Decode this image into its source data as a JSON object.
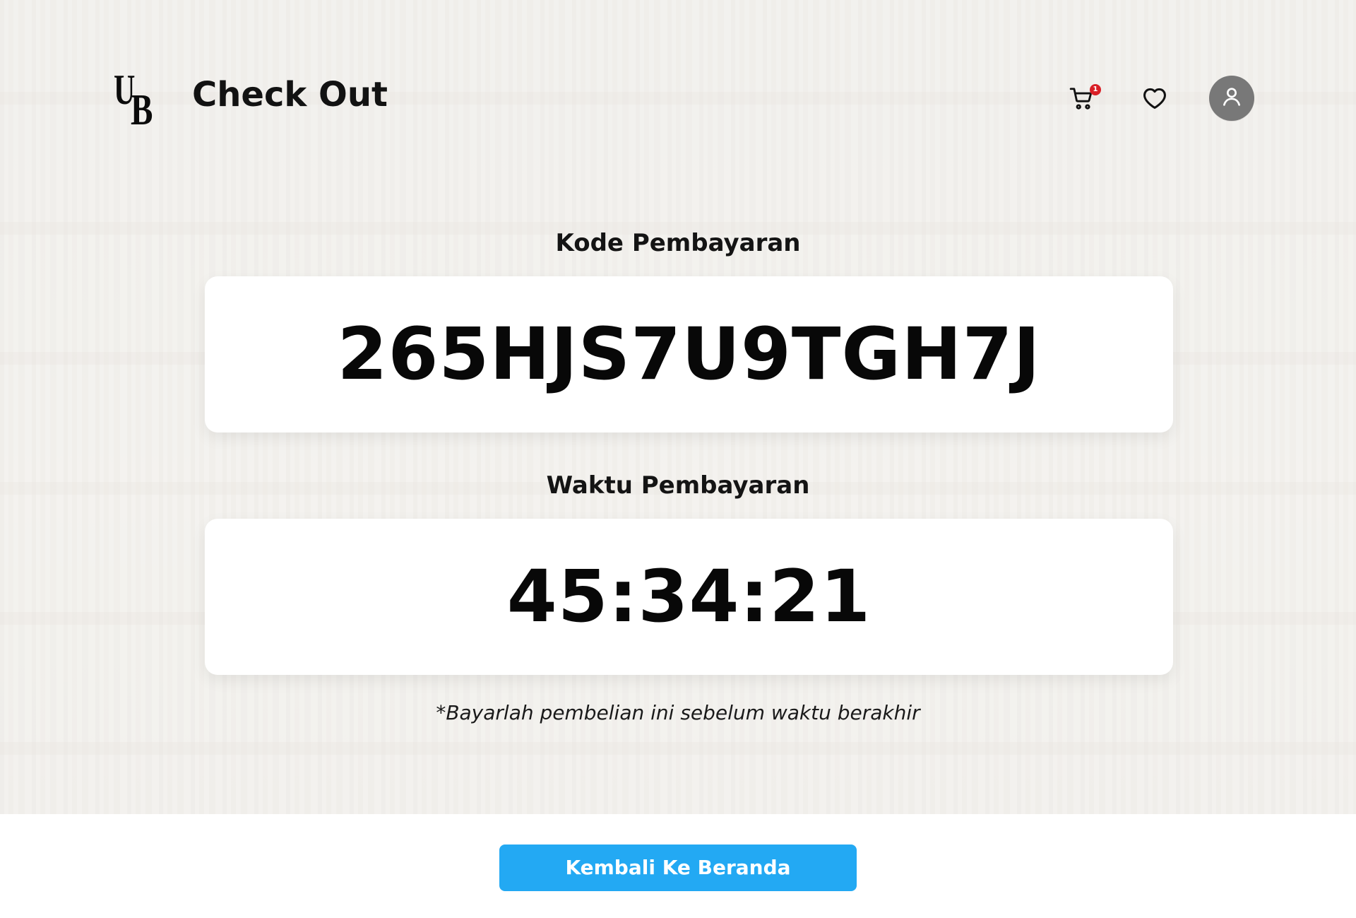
{
  "header": {
    "title": "Check Out",
    "logo_letters": [
      "U",
      "B"
    ],
    "cart_badge": "1",
    "icons": {
      "cart": "cart-icon",
      "wishlist": "heart-icon",
      "account": "user-icon"
    }
  },
  "payment": {
    "code_label": "Kode Pembayaran",
    "code_value": "265HJS7U9TGH7J",
    "time_label": "Waktu Pembayaran",
    "time_value": "45:34:21",
    "notice": "*Bayarlah pembelian ini sebelum waktu berakhir"
  },
  "footer": {
    "button_label": "Kembali Ke Beranda"
  },
  "colors": {
    "accent": "#23A9F3",
    "badge": "#D91F26",
    "avatar": "#787878"
  }
}
